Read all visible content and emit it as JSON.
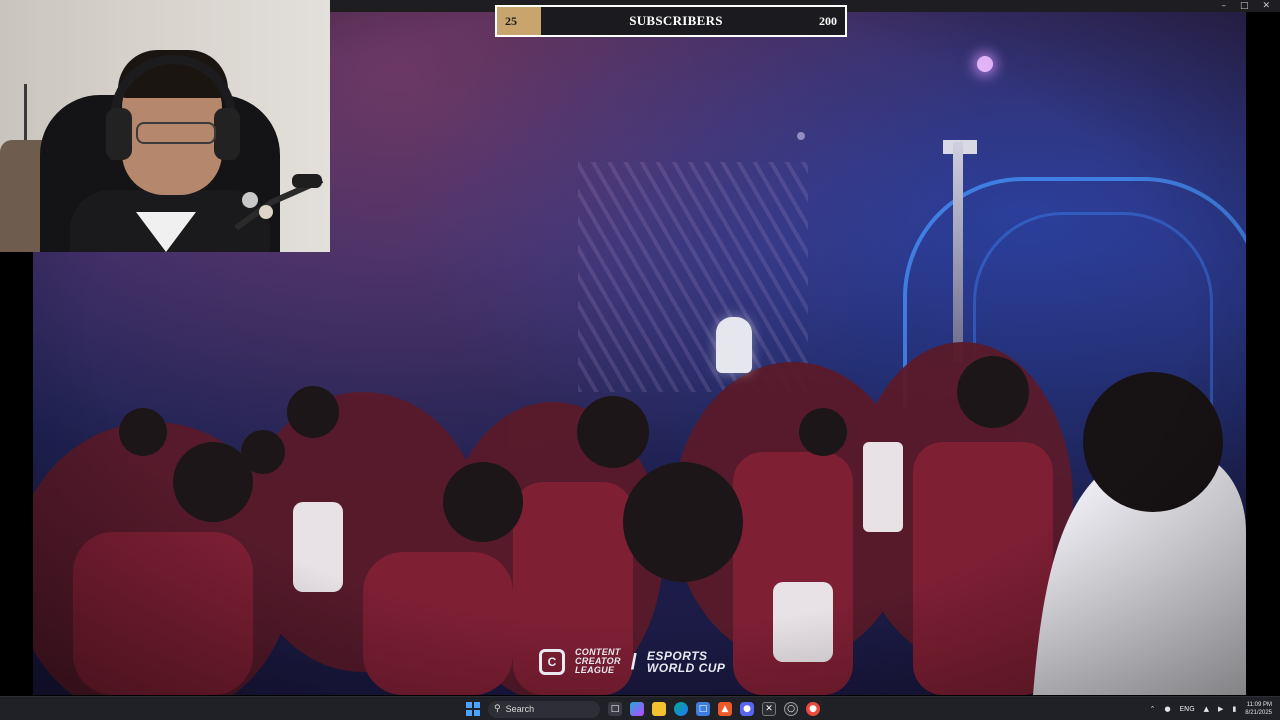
{
  "window": {
    "controls": [
      "–",
      "□",
      "✕"
    ]
  },
  "overlay": {
    "subscriber_goal": {
      "current": "25",
      "label": "SUBSCRIBERS",
      "target": "200",
      "progress": 0.125
    }
  },
  "video": {
    "watermark": {
      "left_logo_text": [
        "CONTENT",
        "CREATOR",
        "LEAGUE"
      ],
      "separator": "/",
      "right_logo_text": [
        "ESPORTS",
        "WORLD CUP"
      ]
    }
  },
  "taskbar": {
    "search_label": "Search",
    "apps": [
      "file-explorer",
      "copilot",
      "folder",
      "edge",
      "store",
      "brave",
      "discord",
      "xbox",
      "media",
      "steam"
    ],
    "language": "ENG",
    "time": "11:09 PM",
    "date": "8/21/2025"
  },
  "colors": {
    "goal_fill": "#c7a56c",
    "taskbar_bg": "#202027",
    "windows_blue": "#4aa4ff"
  }
}
